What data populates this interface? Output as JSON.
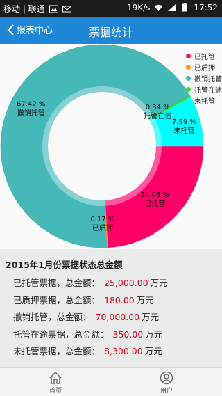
{
  "status_bar": {
    "carrier": "移动 | 联通",
    "speed": "19K/s",
    "time": "17:52"
  },
  "nav": {
    "back_label": "报表中心",
    "title": "票据统计"
  },
  "chart_data": {
    "type": "pie",
    "categories": [
      "已托管",
      "已质押",
      "撤销托管",
      "托管在途",
      "未托管"
    ],
    "values": [
      24.08,
      0.17,
      67.42,
      0.34,
      7.99
    ],
    "value_labels": [
      "24.08 %",
      "0.17 %",
      "67.42 %",
      "0.34 %",
      "7.99 %"
    ],
    "colors": [
      "#ff0066",
      "#ff9900",
      "#46b8b8",
      "#33dd33",
      "#00ffff"
    ],
    "legend": [
      "已托管",
      "已质押",
      "撤销托管",
      "托管在途",
      "未托管"
    ],
    "legend_position": "top-right",
    "donut": true
  },
  "summary": {
    "title": "2015年1月份票据状态总金额",
    "unit": "万元",
    "rows": [
      {
        "label": "已托管票据，总金额：",
        "amount": "25,000.00"
      },
      {
        "label": "已质押票据，总金额：",
        "amount": "180.00"
      },
      {
        "label": "撤销托管，总金额：",
        "amount": "70,000.00"
      },
      {
        "label": "托管在途票据，总金额：",
        "amount": "350.00"
      },
      {
        "label": "未托管票据，总金额：",
        "amount": "8,300.00"
      }
    ]
  },
  "tabs": [
    {
      "label": "首页",
      "icon": "home-icon"
    },
    {
      "label": "用户",
      "icon": "user-icon"
    }
  ]
}
